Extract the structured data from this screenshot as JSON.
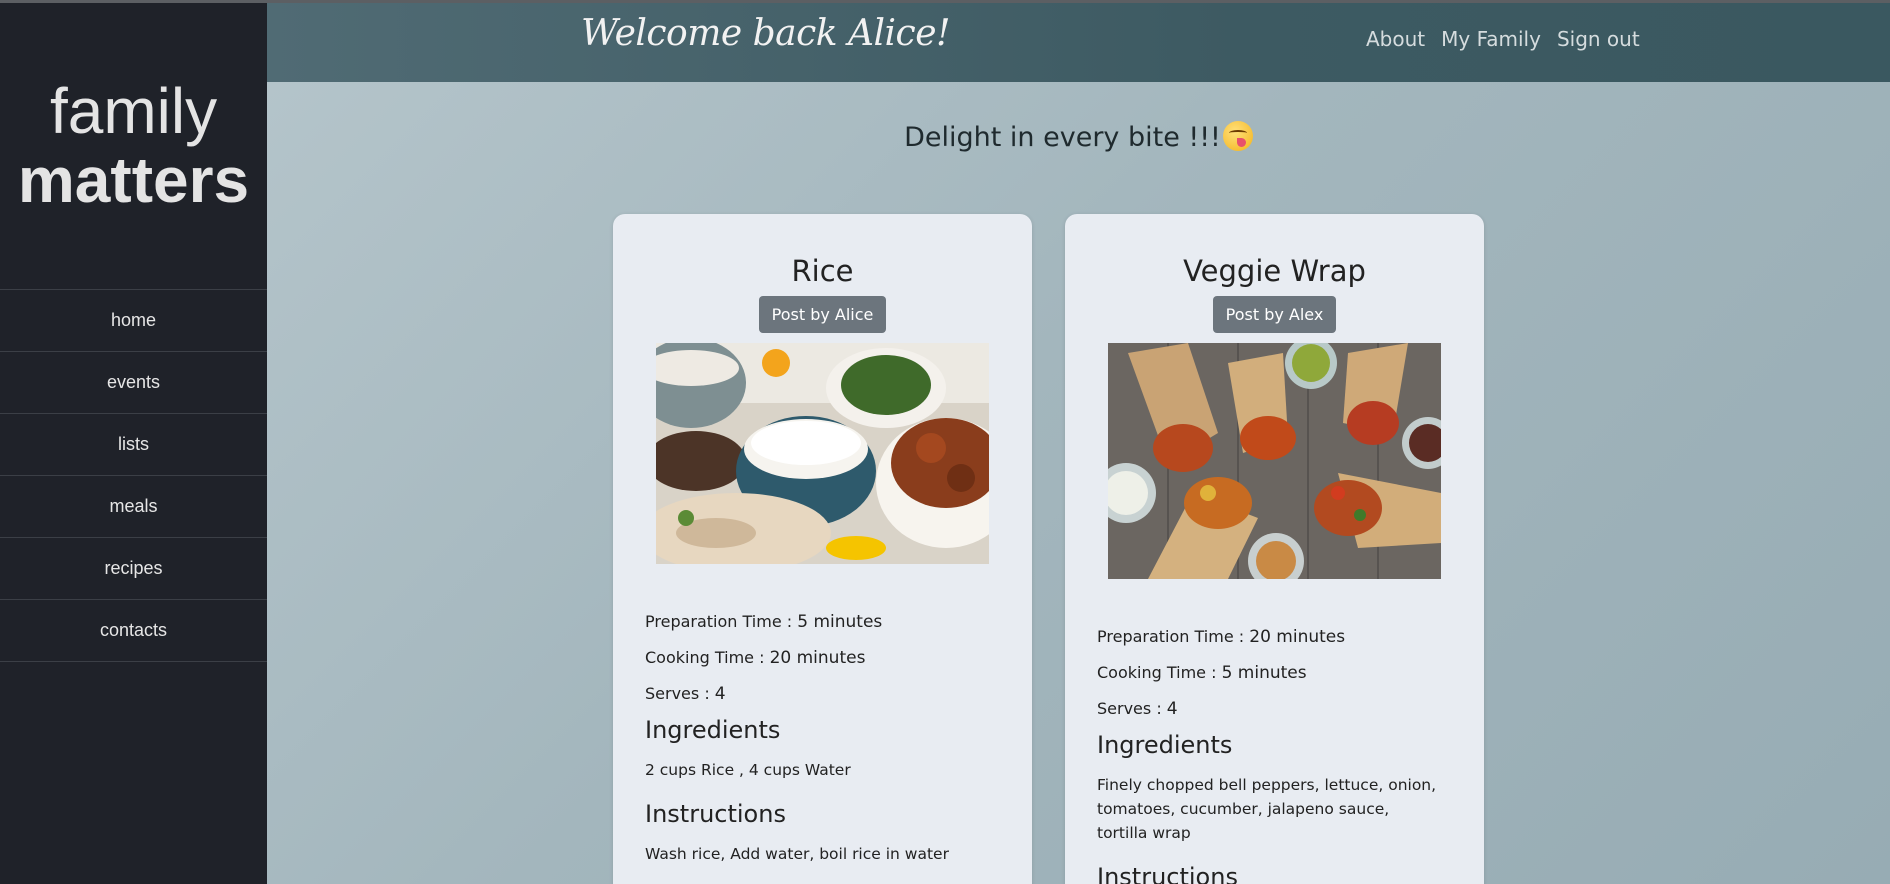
{
  "sidebar": {
    "brand_line1": "family",
    "brand_line2": "matters",
    "items": [
      {
        "label": "home"
      },
      {
        "label": "events"
      },
      {
        "label": "lists"
      },
      {
        "label": "meals"
      },
      {
        "label": "recipes"
      },
      {
        "label": "contacts"
      }
    ]
  },
  "header": {
    "welcome": "Welcome back Alice!",
    "nav": [
      {
        "label": "About"
      },
      {
        "label": "My Family"
      },
      {
        "label": "Sign out"
      }
    ]
  },
  "tagline": "Delight in every bite !!!",
  "recipes": [
    {
      "title": "Rice",
      "author": "Post by Alice",
      "photo_icon": "rice-bowl-image",
      "prep_label": "Preparation Time :",
      "prep_value": "5 minutes",
      "cook_label": "Cooking Time :",
      "cook_value": "20 minutes",
      "serves_label": "Serves :",
      "serves_value": "4",
      "ingredients_heading": "Ingredients",
      "ingredients": "2 cups Rice , 4 cups Water",
      "instructions_heading": "Instructions",
      "instructions": "Wash rice, Add water, boil rice in water"
    },
    {
      "title": "Veggie Wrap",
      "author": "Post by Alex",
      "photo_icon": "veggie-wrap-image",
      "prep_label": "Preparation Time :",
      "prep_value": "20 minutes",
      "cook_label": "Cooking Time :",
      "cook_value": "5 minutes",
      "serves_label": "Serves :",
      "serves_value": "4",
      "ingredients_heading": "Ingredients",
      "ingredients": "Finely chopped bell peppers, lettuce, onion, tomatoes, cucumber, jalapeno sauce, tortilla wrap",
      "instructions_heading": "Instructions"
    }
  ],
  "colors": {
    "sidebar_bg": "#1f2229",
    "header_bg": "#3d5a62",
    "card_bg": "#e8ecf2",
    "author_button": "#6c757d"
  }
}
